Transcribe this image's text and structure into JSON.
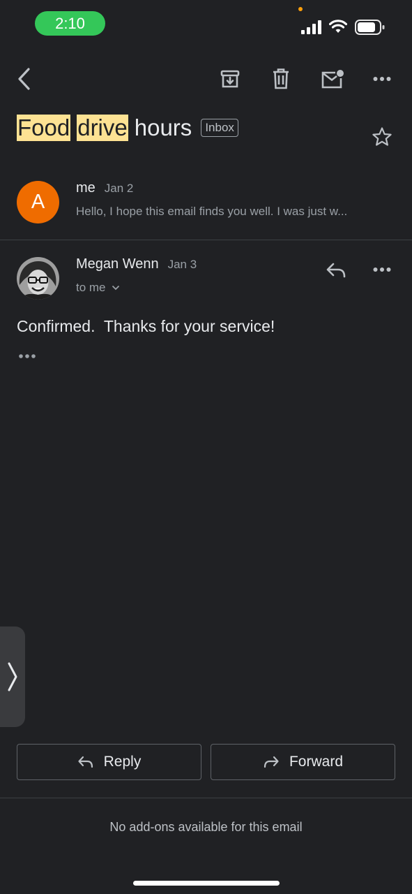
{
  "status_bar": {
    "time": "2:10"
  },
  "toolbar": {
    "back_icon": "chevron-left-icon",
    "archive_icon": "archive-icon",
    "delete_icon": "trash-icon",
    "mark_unread_icon": "mail-unread-icon",
    "more_icon": "more-horizontal-icon"
  },
  "thread": {
    "subject_words": [
      "Food",
      "drive",
      "hours"
    ],
    "label": "Inbox"
  },
  "messages": [
    {
      "avatar_letter": "A",
      "avatar_color": "#ef6c00",
      "sender": "me",
      "date": "Jan 2",
      "snippet": "Hello, I hope this email finds you well. I was just w..."
    },
    {
      "sender": "Megan Wenn",
      "date": "Jan 3",
      "recipient": "to me",
      "body": "Confirmed.  Thanks for your service!"
    }
  ],
  "actions": {
    "reply_label": "Reply",
    "forward_label": "Forward"
  },
  "footer": {
    "addons_text": "No add-ons available for this email"
  },
  "colors": {
    "background": "#202124",
    "highlight": "#fde293",
    "status_pill": "#34c759"
  }
}
